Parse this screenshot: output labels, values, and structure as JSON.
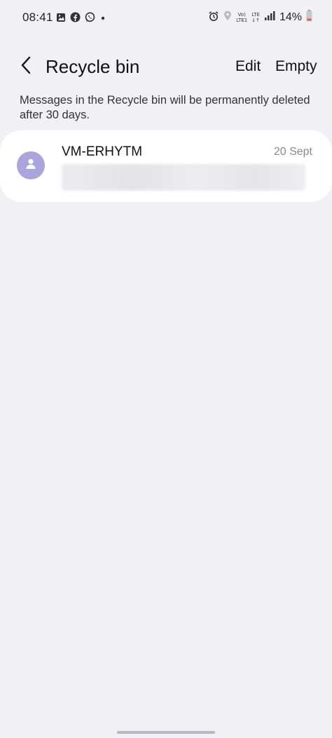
{
  "status_bar": {
    "time": "08:41",
    "battery": "14%",
    "net_top": "Vo)",
    "net_bottom": "LTE1",
    "lte_label": "LTE"
  },
  "app_bar": {
    "title": "Recycle bin",
    "edit_label": "Edit",
    "empty_label": "Empty"
  },
  "notice": "Messages in the Recycle bin will be permanently deleted after 30 days.",
  "messages": [
    {
      "sender": "VM-ERHYTM",
      "date": "20 Sept"
    }
  ],
  "colors": {
    "background": "#f1f0f5",
    "card": "#ffffff",
    "avatar": "#aaa5dc",
    "battery_low": "#e0633a"
  }
}
